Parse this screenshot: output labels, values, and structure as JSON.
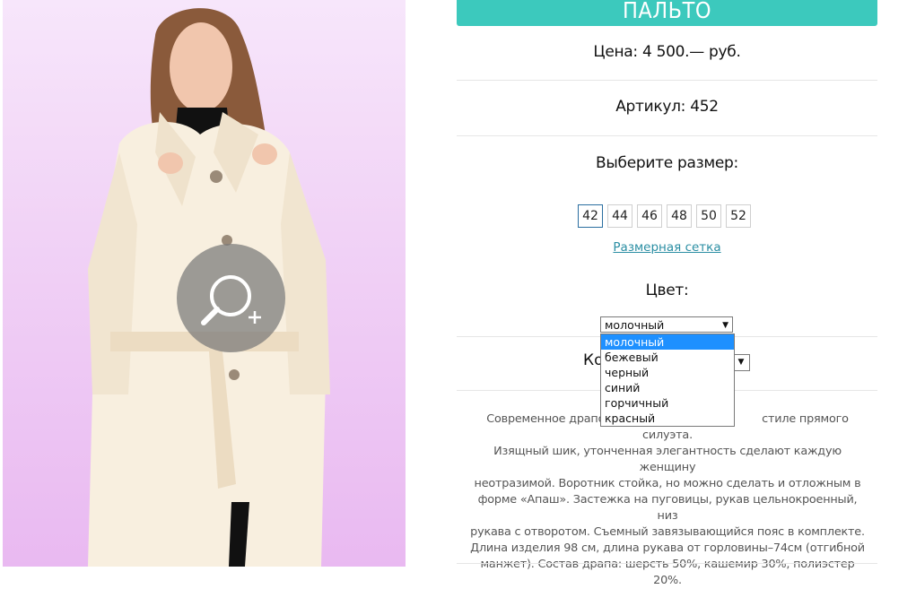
{
  "product": {
    "title": "ПАЛЬТО",
    "price": "Цена: 4 500.— руб.",
    "article": "Артикул: 452"
  },
  "size": {
    "label": "Выберите размер:",
    "options": [
      "42",
      "44",
      "46",
      "48",
      "50",
      "52"
    ],
    "selected": "42",
    "chart_link": "Размерная сетка"
  },
  "color": {
    "label": "Цвет:",
    "selected": "молочный",
    "options": [
      "молочный",
      "бежевый",
      "черный",
      "синий",
      "горчичный",
      "красный"
    ]
  },
  "quantity": {
    "label_visible": "Ко"
  },
  "description": "Современное драповое пальто в классическом стиле прямого силуэта. Изящный шик, утонченная элегантность сделают каждую женщину неотразимой. Воротник стойка, но можно сделать и отложным в форме «Апаш». Застежка на пуговицы, рукав цельнокроенный, низ рукава с отворотом. Съемный завязывающийся пояс в комплекте. Длина изделия 98 см, длина рукава от горловины–74см (отгибной манжет). Состав драпа: шерсть 50%, кашемир 30%, полиэстер 20%.",
  "description_lines": [
    "Современное драпово",
    "стиле прямого силуэта.",
    "Изящный шик, утонченная элегантность сделают каждую женщину",
    "неотразимой. Воротник стойка, но можно сделать и отложным в",
    "форме «Апаш». Застежка на пуговицы, рукав цельнокроенный, низ",
    "рукава с отворотом. Съемный завязывающийся пояс в комплекте.",
    "Длина изделия 98 см, длина рукава от горловины–74см (отгибной",
    "манжет). Состав драпа: шерсть 50%, кашемир 30%, полиэстер 20%."
  ],
  "icons": {
    "zoom": "zoom-in-icon",
    "dropdown": "chevron-down-icon"
  },
  "colors": {
    "accent": "#3cc9bd",
    "link": "#2a8ea3",
    "highlight": "#1e90ff"
  }
}
